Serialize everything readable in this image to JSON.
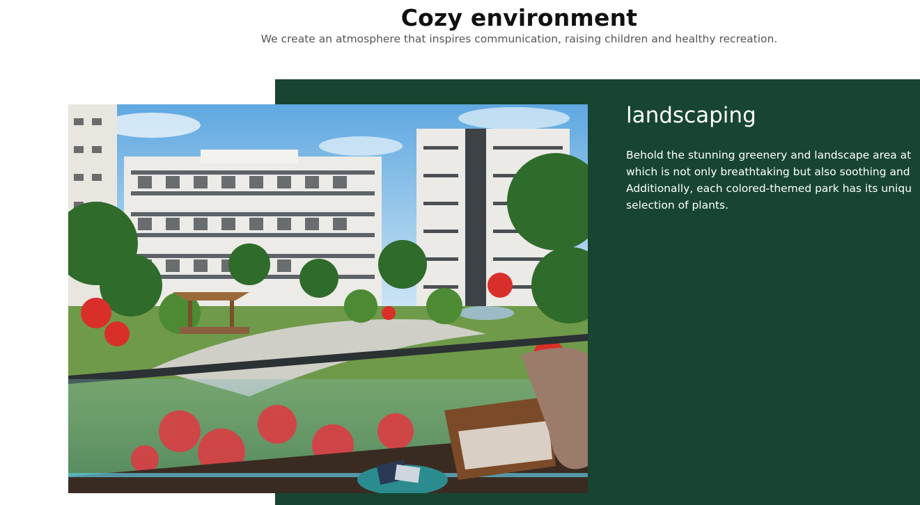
{
  "section": {
    "title": "Cozy environment",
    "subtitle": "We create an atmosphere that inspires communication, raising children and healthy recreation."
  },
  "feature": {
    "title": "landscaping",
    "description_lines": [
      "Behold the stunning greenery and landscape area at",
      "which is not only breathtaking but also soothing and",
      "Additionally, each colored-themed park has its uniqu",
      "selection of plants."
    ]
  },
  "colors": {
    "panel_green": "#174532",
    "heading": "#111111",
    "subtitle": "#555555"
  }
}
